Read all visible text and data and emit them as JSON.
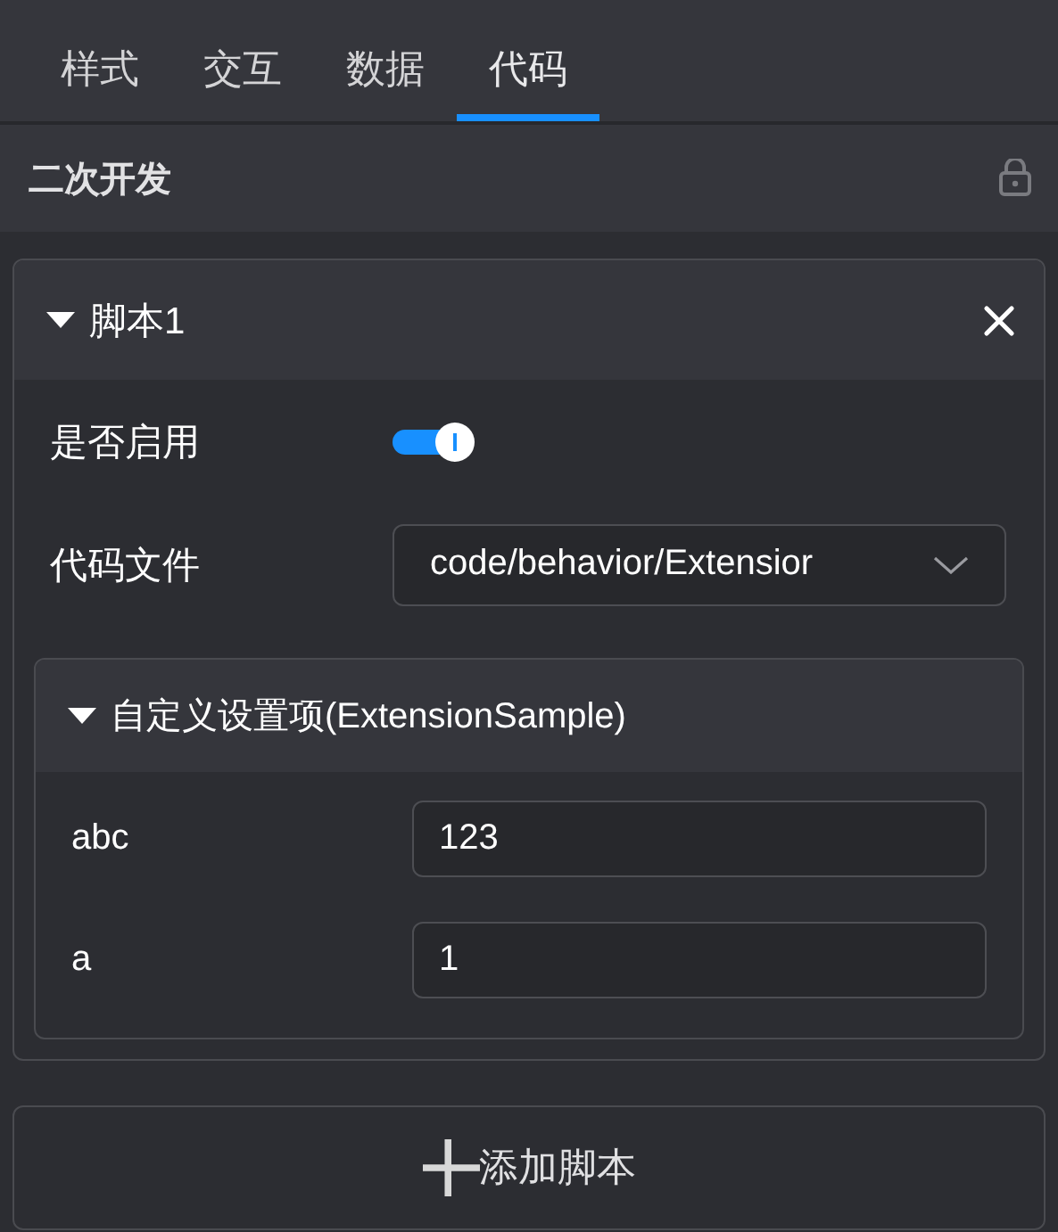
{
  "tabs": [
    {
      "label": "样式",
      "selected": false
    },
    {
      "label": "交互",
      "selected": false
    },
    {
      "label": "数据",
      "selected": false
    },
    {
      "label": "代码",
      "selected": true
    }
  ],
  "section": {
    "title": "二次开发",
    "locked": true
  },
  "scripts": [
    {
      "title": "脚本1",
      "expanded": true,
      "fields": [
        {
          "kind": "toggle",
          "label": "是否启用",
          "on": true
        },
        {
          "kind": "select",
          "label": "代码文件",
          "value": "code/behavior/Extensior"
        }
      ],
      "settings": {
        "title": "自定义设置项(ExtensionSample)",
        "expanded": true,
        "items": [
          {
            "label": "abc",
            "value": "123"
          },
          {
            "label": "a",
            "value": "1"
          }
        ]
      }
    }
  ],
  "add_button": {
    "label": "添加脚本"
  }
}
